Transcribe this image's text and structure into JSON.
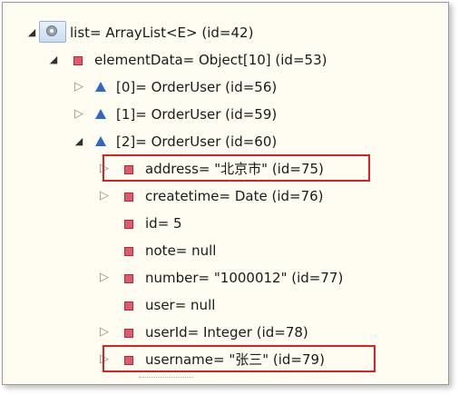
{
  "tree": {
    "root": {
      "label": "list= ArrayList<E>  (id=42)",
      "expanded": true
    },
    "elementData": {
      "label": "elementData= Object[10]  (id=53)",
      "expanded": true
    },
    "item0": {
      "label": "[0]= OrderUser  (id=56)",
      "expanded": false
    },
    "item1": {
      "label": "[1]= OrderUser  (id=59)",
      "expanded": false
    },
    "item2": {
      "label": "[2]= OrderUser  (id=60)",
      "expanded": true
    },
    "fields": [
      {
        "label": "address= \"北京市\" (id=75)",
        "expandable": true,
        "highlighted": true
      },
      {
        "label": "createtime= Date  (id=76)",
        "expandable": true,
        "highlighted": false
      },
      {
        "label": "id= 5",
        "expandable": false,
        "highlighted": false
      },
      {
        "label": "note= null",
        "expandable": false,
        "highlighted": false
      },
      {
        "label": "number= \"1000012\" (id=77)",
        "expandable": true,
        "highlighted": false
      },
      {
        "label": "user= null",
        "expandable": false,
        "highlighted": false
      },
      {
        "label": "userId= Integer  (id=78)",
        "expandable": true,
        "highlighted": false
      },
      {
        "label": "username= \"张三\" (id=79)",
        "expandable": true,
        "highlighted": true
      }
    ]
  },
  "icons": {
    "expanded": "black-down-triangle",
    "collapsed": "white-right-triangle",
    "field": "red-square-field-icon",
    "array_element": "blue-triangle-icon",
    "static": "static-field-icon"
  },
  "colors": {
    "background": "#fffdf2",
    "field_icon": "#e05a6a",
    "element_icon": "#2e67c8",
    "highlight_border": "#e02020",
    "selection": "#c9dcf1"
  }
}
